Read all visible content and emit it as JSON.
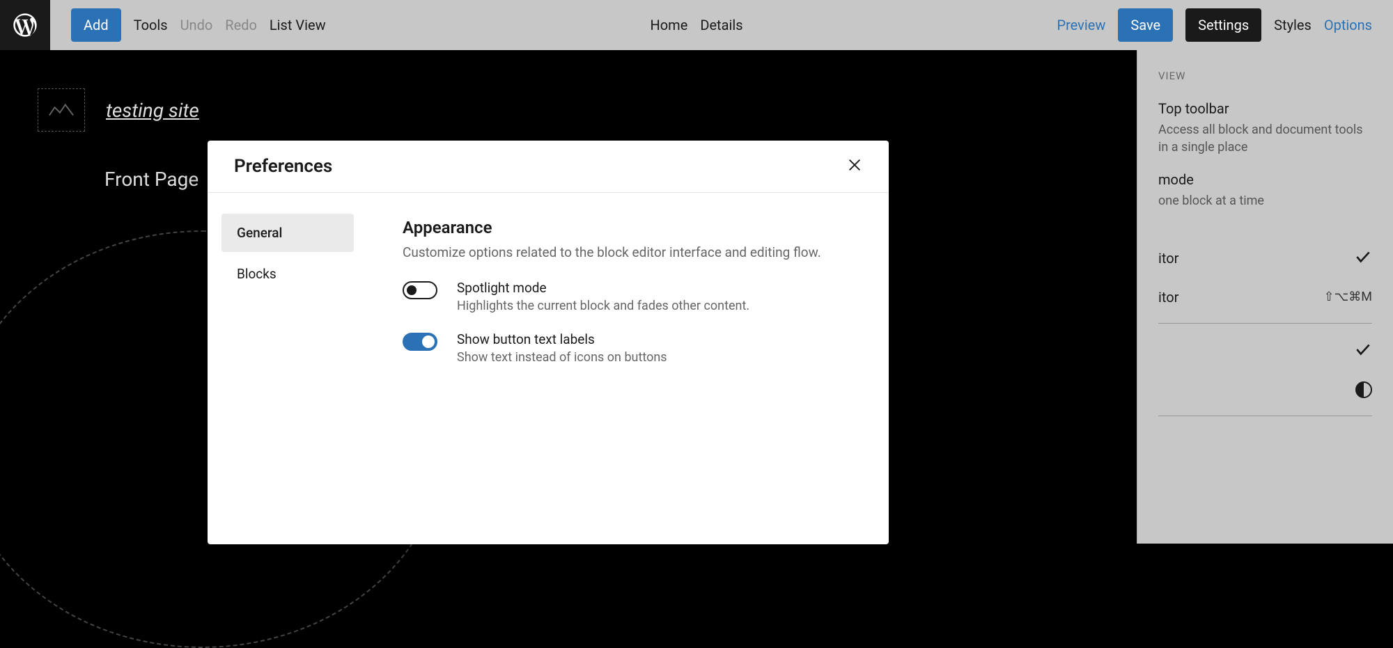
{
  "topbar": {
    "add": "Add",
    "tools": "Tools",
    "undo": "Undo",
    "redo": "Redo",
    "listView": "List View",
    "home": "Home",
    "details": "Details",
    "preview": "Preview",
    "save": "Save",
    "settings": "Settings",
    "styles": "Styles",
    "options": "Options"
  },
  "canvas": {
    "siteTitle": "testing site",
    "pageTitle": "Front Page"
  },
  "optionsPanel": {
    "heading": "VIEW",
    "items": [
      {
        "title": "Top toolbar",
        "desc": "Access all block and document tools in a single place"
      },
      {
        "title": "mode",
        "desc": "one block at a time"
      }
    ],
    "rows": [
      {
        "label": "itor",
        "checked": true,
        "shortcut": ""
      },
      {
        "label": "itor",
        "checked": false,
        "shortcut": "⇧⌥⌘M"
      }
    ]
  },
  "modal": {
    "title": "Preferences",
    "tabs": {
      "general": "General",
      "blocks": "Blocks"
    },
    "section": {
      "title": "Appearance",
      "desc": "Customize options related to the block editor interface and editing flow."
    },
    "toggles": [
      {
        "label": "Spotlight mode",
        "desc": "Highlights the current block and fades other content.",
        "on": false
      },
      {
        "label": "Show button text labels",
        "desc": "Show text instead of icons on buttons",
        "on": true
      }
    ]
  }
}
